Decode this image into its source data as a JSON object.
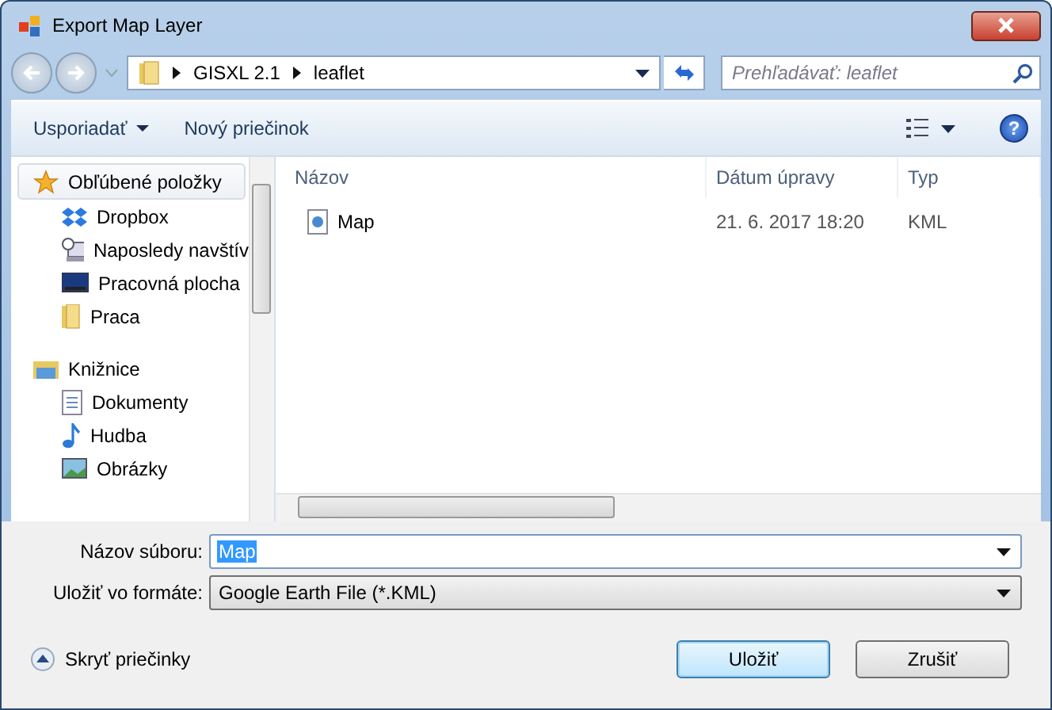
{
  "window": {
    "title": "Export Map Layer"
  },
  "address_bar": {
    "path": [
      "GISXL 2.1",
      "leaflet"
    ]
  },
  "search": {
    "placeholder": "Prehľadávať: leaflet"
  },
  "toolbar": {
    "buttons": [
      {
        "label": "Usporiadať",
        "dropdown": true
      },
      {
        "label": "Nový priečinok",
        "dropdown": false
      }
    ]
  },
  "sidebar": {
    "groups": [
      {
        "label": "Obľúbené položky",
        "kind": "star",
        "selected": true,
        "children": [
          {
            "label": "Dropbox",
            "kind": "dropbox",
            "selected": false
          },
          {
            "label": "Naposledy navštív",
            "kind": "recent",
            "selected": false
          },
          {
            "label": "Pracovná plocha",
            "kind": "desktop",
            "selected": false
          },
          {
            "label": "Praca",
            "kind": "folder",
            "selected": false
          }
        ]
      },
      {
        "label": "Knižnice",
        "kind": "library",
        "selected": false,
        "children": [
          {
            "label": "Dokumenty",
            "kind": "document",
            "selected": false
          },
          {
            "label": "Hudba",
            "kind": "music",
            "selected": false
          },
          {
            "label": "Obrázky",
            "kind": "picture",
            "selected": false
          }
        ]
      }
    ]
  },
  "table": {
    "columns": [
      "Názov",
      "Dátum úpravy",
      "Typ"
    ],
    "rows": [
      {
        "cells": [
          "Map",
          "21. 6. 2017 18:20",
          "KML"
        ],
        "selected": false
      }
    ]
  },
  "file_name": {
    "label": "Názov súboru:",
    "value": "Map",
    "text_selected": true
  },
  "file_type": {
    "label": "Uložiť vo formáte:",
    "value": "Google Earth File (*.KML)"
  },
  "help": {
    "label": "?"
  },
  "hide_folders": {
    "label": "Skryť priečinky"
  },
  "buttons": [
    {
      "label": "Uložiť",
      "default": true
    },
    {
      "label": "Zrušiť",
      "default": false
    }
  ]
}
